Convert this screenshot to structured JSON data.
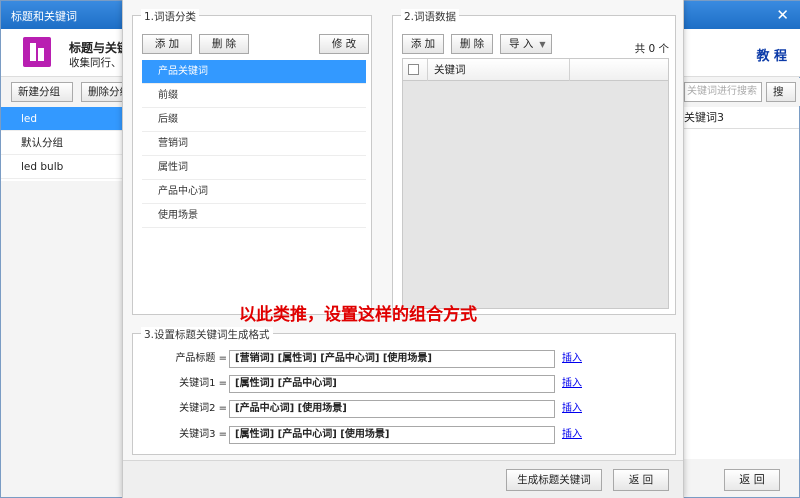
{
  "window": {
    "title": "标题和关键词",
    "close_glyph": "✕",
    "app_name": "标题与关键词",
    "app_subtitle": "收集同行、管理",
    "tutorial": "教 程"
  },
  "toolbar": {
    "new_group": "新建分组",
    "delete_group": "删除分组",
    "search_placeholder": "关键词进行搜索",
    "search": "搜 索"
  },
  "groups": [
    "led",
    "默认分组",
    "led bulb"
  ],
  "bg_column": "关键词3",
  "bg_return": "返 回",
  "dialog": {
    "section1": {
      "legend": "1.词语分类",
      "add": "添 加",
      "delete": "删 除",
      "edit": "修 改",
      "items": [
        "产品关键词",
        "前缀",
        "后缀",
        "营销词",
        "属性词",
        "产品中心词",
        "使用场景"
      ]
    },
    "section2": {
      "legend": "2.词语数据",
      "add": "添 加",
      "delete": "删 除",
      "import": "导 入",
      "caret": "▼",
      "total": "共 0 个",
      "col_keyword": "关键词"
    },
    "annotation": "以此类推，设置这样的组合方式",
    "section3": {
      "legend": "3.设置标题关键词生成格式",
      "rows": [
        {
          "label": "产品标题 =",
          "value": "[营销词] [属性词] [产品中心词] [使用场景]",
          "link": "插入"
        },
        {
          "label": "关键词1 =",
          "value": "[属性词] [产品中心词]",
          "link": "插入"
        },
        {
          "label": "关键词2 =",
          "value": "[产品中心词] [使用场景]",
          "link": "插入"
        },
        {
          "label": "关键词3 =",
          "value": "[属性词] [产品中心词]  [使用场景]",
          "link": "插入"
        }
      ]
    },
    "footer": {
      "generate": "生成标题关键词",
      "return": "返 回"
    }
  },
  "colors": {
    "title_bar": "#1e6fc6",
    "selected": "#3399ff",
    "annotation": "#e00000",
    "link": "#0000ee"
  }
}
